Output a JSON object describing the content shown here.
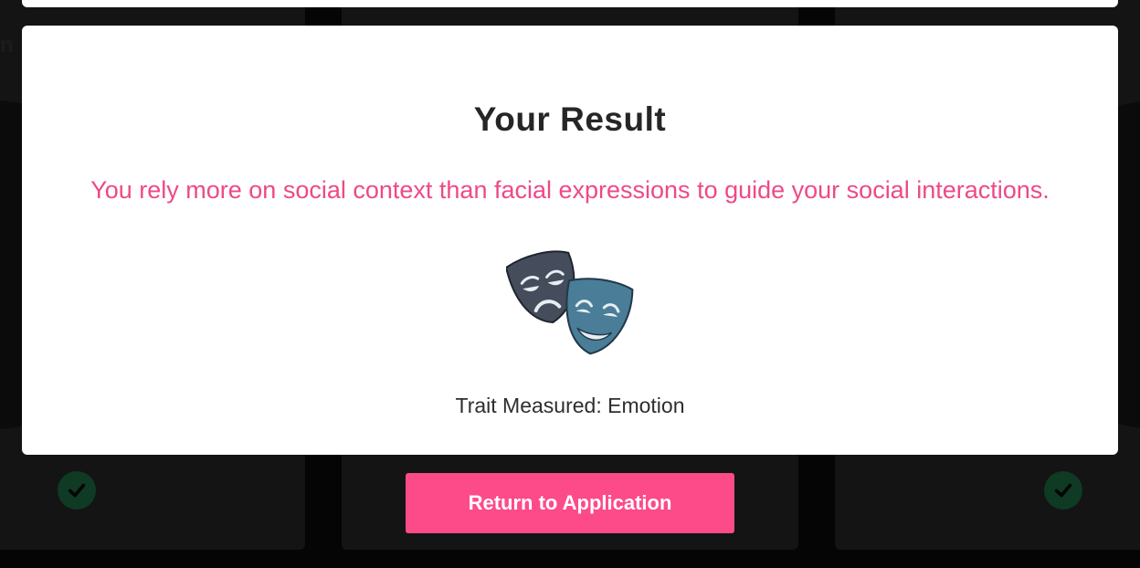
{
  "modal": {
    "title": "Your Result",
    "result_text": "You rely more on social context than facial expressions to guide your social interactions.",
    "trait_label": "Trait Measured: Emotion",
    "illustration_icon": "theater-masks-icon"
  },
  "actions": {
    "return_label": "Return to Application"
  },
  "background": {
    "check_icon": "check-circle-icon",
    "fragment_text": "n"
  },
  "colors": {
    "accent": "#fd4a89",
    "result_text": "#ee4987",
    "mask_dark": "#454d5c",
    "mask_blue": "#4a7d97",
    "check_green": "#0f3a23"
  }
}
